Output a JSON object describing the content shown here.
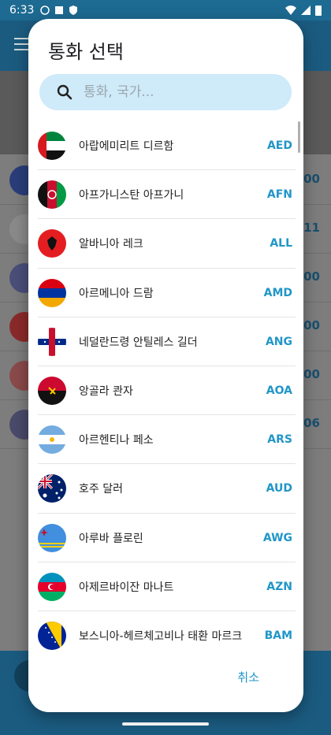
{
  "status_bar": {
    "time": "6:33"
  },
  "dialog": {
    "title": "통화 선택",
    "search_placeholder": "통화, 국가...",
    "cancel_label": "취소"
  },
  "currencies": [
    {
      "name": "아랍에미리트 디르함",
      "code": "AED",
      "flag_icon": "uae-flag-icon"
    },
    {
      "name": "아프가니스탄 아프가니",
      "code": "AFN",
      "flag_icon": "afghanistan-flag-icon"
    },
    {
      "name": "알바니아 레크",
      "code": "ALL",
      "flag_icon": "albania-flag-icon"
    },
    {
      "name": "아르메니아 드람",
      "code": "AMD",
      "flag_icon": "armenia-flag-icon"
    },
    {
      "name": "네덜란드령 안틸레스 길더",
      "code": "ANG",
      "flag_icon": "netherlands-antilles-flag-icon"
    },
    {
      "name": "앙골라 콴자",
      "code": "AOA",
      "flag_icon": "angola-flag-icon"
    },
    {
      "name": "아르헨티나 페소",
      "code": "ARS",
      "flag_icon": "argentina-flag-icon"
    },
    {
      "name": "호주 달러",
      "code": "AUD",
      "flag_icon": "australia-flag-icon"
    },
    {
      "name": "아루바 플로린",
      "code": "AWG",
      "flag_icon": "aruba-flag-icon"
    },
    {
      "name": "아제르바이잔 마나트",
      "code": "AZN",
      "flag_icon": "azerbaijan-flag-icon"
    },
    {
      "name": "보스니아-헤르체고비나 태환 마르크",
      "code": "BAM",
      "flag_icon": "bosnia-flag-icon"
    }
  ],
  "background": {
    "values": [
      ".00",
      ".11",
      ".00",
      ".00",
      ".00",
      ".06"
    ]
  },
  "colors": {
    "accent": "#2196c8",
    "search_bg": "#cfeaf9",
    "toolbar": "#1b5b80"
  }
}
